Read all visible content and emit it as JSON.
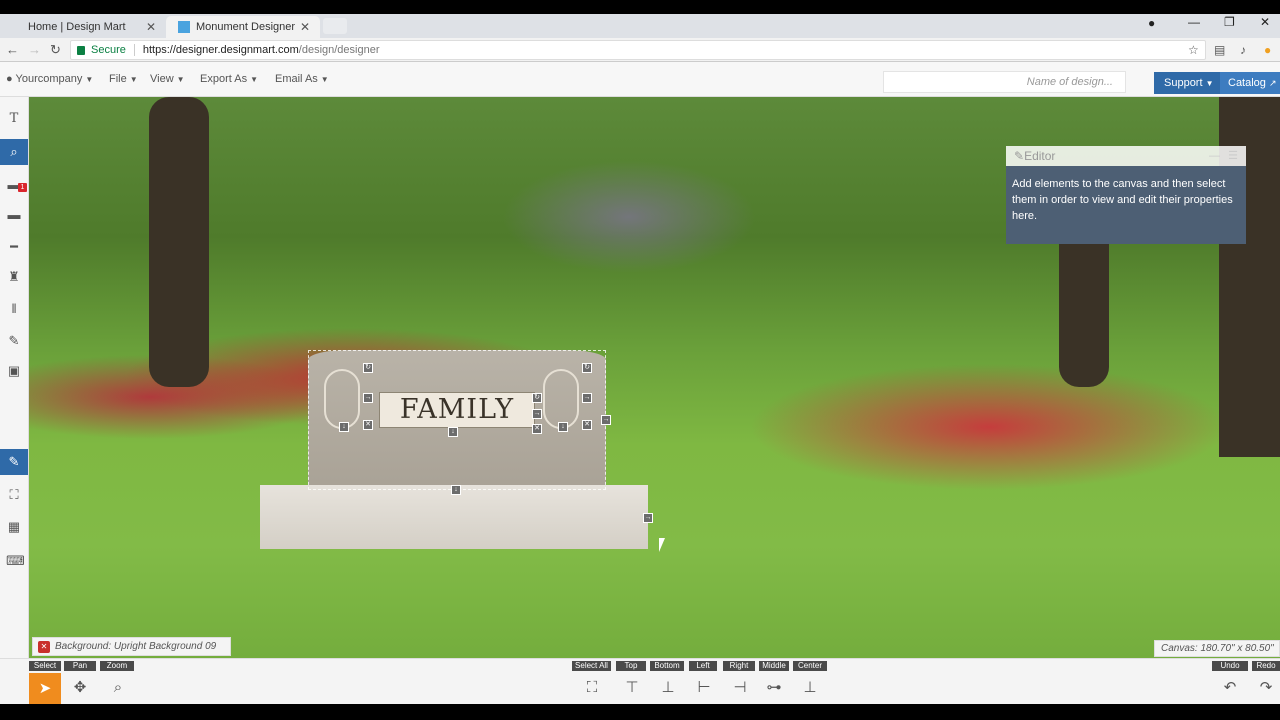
{
  "browser": {
    "tabs": [
      {
        "label": "Home | Design Mart"
      },
      {
        "label": "Monument Designer"
      }
    ],
    "secure_label": "Secure",
    "url_host": "https://designer.designmart.com",
    "url_path": "/design/designer"
  },
  "menubar": {
    "account": "Yourcompany",
    "file": "File",
    "view": "View",
    "export": "Export As",
    "email": "Email As",
    "name_placeholder": "Name of design...",
    "support": "Support",
    "catalog": "Catalog"
  },
  "monument": {
    "inscription": "FAMILY"
  },
  "editor": {
    "title": "Editor",
    "message": "Add elements to the canvas and then select them in order to view and edit their properties here."
  },
  "status": {
    "background": "Background: Upright Background 09",
    "canvas_size": "Canvas: 180.70\" x 80.50\""
  },
  "bottombar": {
    "modes": [
      "Select",
      "Pan",
      "Zoom"
    ],
    "align": [
      "Select All",
      "Top",
      "Bottom",
      "Left",
      "Right",
      "Middle",
      "Center"
    ],
    "history": [
      "Undo",
      "Redo"
    ]
  },
  "colors": {
    "primary": "#2f6aa8",
    "active_tool": "#f08c1e",
    "editor_body": "#4d5f74"
  }
}
